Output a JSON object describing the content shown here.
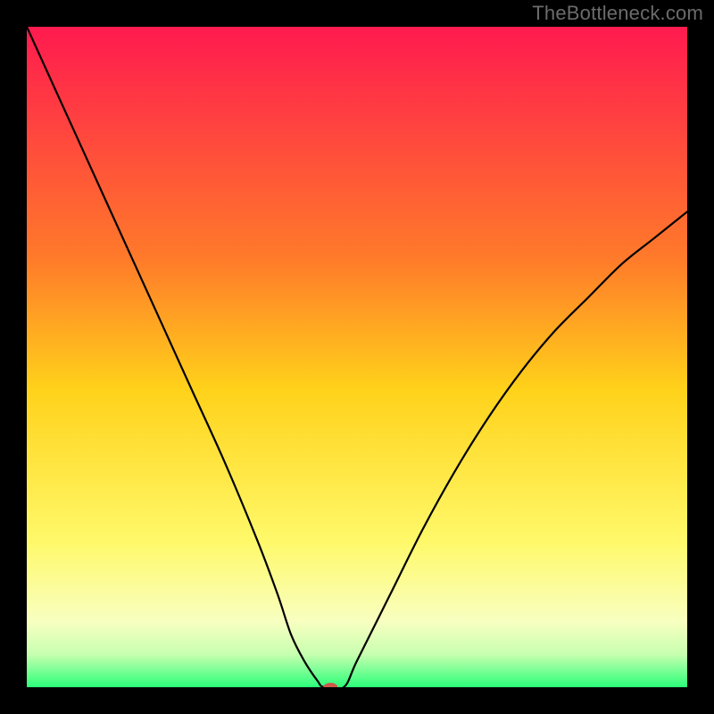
{
  "watermark": "TheBottleneck.com",
  "chart_data": {
    "type": "line",
    "title": "",
    "xlabel": "",
    "ylabel": "",
    "xlim": [
      0,
      100
    ],
    "ylim": [
      0,
      100
    ],
    "background_gradient": {
      "stops": [
        {
          "offset": 0,
          "color": "#ff1a4f"
        },
        {
          "offset": 35,
          "color": "#ff7a2a"
        },
        {
          "offset": 55,
          "color": "#ffd21a"
        },
        {
          "offset": 78,
          "color": "#fff96a"
        },
        {
          "offset": 90,
          "color": "#f8ffc0"
        },
        {
          "offset": 95,
          "color": "#c8ffb0"
        },
        {
          "offset": 100,
          "color": "#2bff7a"
        }
      ]
    },
    "series": [
      {
        "name": "bottleneck-curve",
        "color": "#000000",
        "stroke_width": 2.2,
        "x": [
          0,
          5,
          10,
          15,
          20,
          25,
          30,
          35,
          38,
          40,
          42,
          44,
          45,
          48,
          50,
          55,
          60,
          65,
          70,
          75,
          80,
          85,
          90,
          95,
          100
        ],
        "values": [
          100,
          89,
          78,
          67,
          56,
          45,
          34,
          22,
          14,
          8,
          4,
          1,
          0,
          0,
          4,
          14,
          24,
          33,
          41,
          48,
          54,
          59,
          64,
          68,
          72
        ]
      }
    ],
    "marker": {
      "name": "optimum-marker",
      "x": 46,
      "y": 0,
      "color": "#cc5a4a",
      "rx": 8,
      "ry": 5
    }
  }
}
